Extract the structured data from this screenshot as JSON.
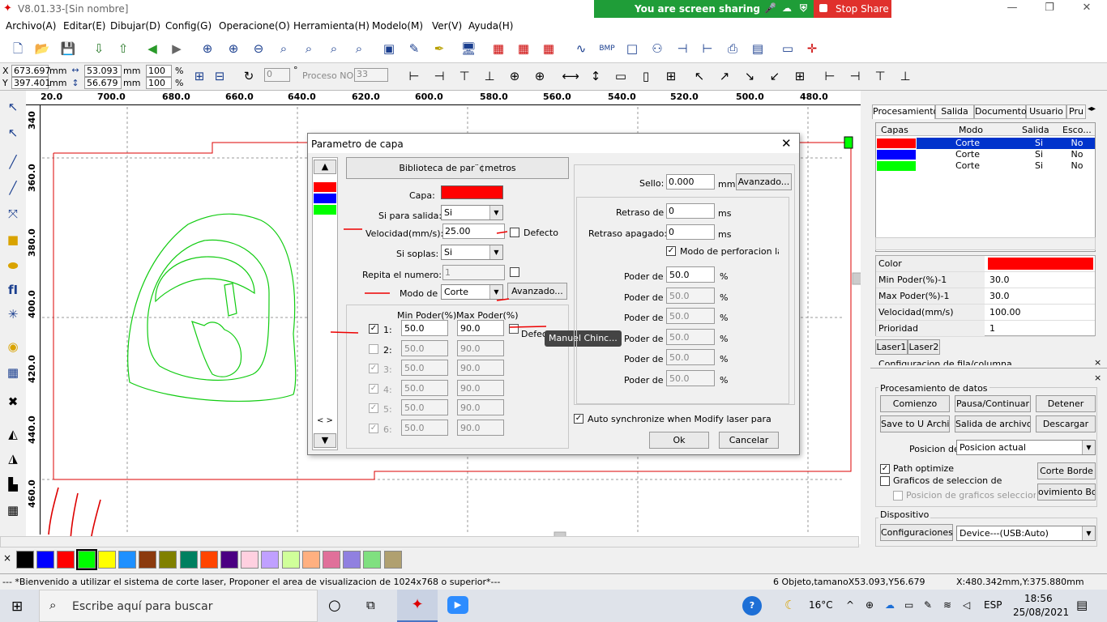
{
  "window": {
    "title": "V8.01.33-[Sin nombre]"
  },
  "screen_share": {
    "text": "You are screen sharing",
    "stop": "Stop Share"
  },
  "menu": [
    "Archivo(A)",
    "Editar(E)",
    "Dibujar(D)",
    "Config(G)",
    "Operacione(O)",
    "Herramienta(H)",
    "Modelo(M)",
    "Ver(V)",
    "Ayuda(H)"
  ],
  "coords": {
    "x_label": "X",
    "y_label": "Y",
    "x": "673.697",
    "y": "397.401",
    "unit": "mm",
    "w": "53.093",
    "h": "56.679",
    "pct_w": "100",
    "pct_h": "100",
    "pct": "%",
    "angle": "0",
    "deg": "°",
    "proceso_label": "Proceso NO:",
    "proceso": "33"
  },
  "ruler_top": [
    "20.0",
    "700.0",
    "680.0",
    "660.0",
    "640.0",
    "620.0",
    "600.0",
    "580.0",
    "560.0",
    "540.0",
    "520.0",
    "500.0",
    "480.0"
  ],
  "ruler_left": [
    "340",
    "360.0",
    "380.0",
    "400.0",
    "420.0",
    "440.0",
    "460.0"
  ],
  "palette_colors": [
    "#000000",
    "#0000ff",
    "#ff0000",
    "#00ff00",
    "#ffff00",
    "#1e90ff",
    "#8b3a0e",
    "#808000",
    "#008060",
    "#ff4500",
    "#4b0082",
    "#ffd0e0",
    "#c0a0ff",
    "#d0ff9a",
    "#ffb080",
    "#e0709a",
    "#9080e0",
    "#80e080",
    "#b0a070"
  ],
  "status": {
    "left": "--- *Bienvenido a utilizar el sistema de corte laser, Proponer el area de visualizacion de 1024x768 o superior*---",
    "mid": "6 Objeto,tamanoX53.093,Y56.679",
    "right": "X:480.342mm,Y:375.880mm"
  },
  "right_panel": {
    "tabs": [
      "Procesamiento",
      "Salida",
      "Documento",
      "Usuario",
      "Pru"
    ],
    "layer_headers": [
      "Capas",
      "Modo",
      "Salida",
      "Esco..."
    ],
    "layers": [
      {
        "color": "#ff0000",
        "mode": "Corte",
        "out": "Si",
        "esc": "No",
        "selected": true
      },
      {
        "color": "#0000ff",
        "mode": "Corte",
        "out": "Si",
        "esc": "No",
        "selected": false
      },
      {
        "color": "#00ff00",
        "mode": "Corte",
        "out": "Si",
        "esc": "No",
        "selected": false
      }
    ],
    "props": [
      {
        "k": "Color",
        "v": ""
      },
      {
        "k": "Min Poder(%)-1",
        "v": "30.0"
      },
      {
        "k": "Max Poder(%)-1",
        "v": "30.0"
      },
      {
        "k": "Velocidad(mm/s)",
        "v": "100.00"
      },
      {
        "k": "Prioridad",
        "v": "1"
      }
    ],
    "prop_color": "#ff0000",
    "laser_tabs": [
      "Laser1",
      "Laser2"
    ],
    "cut_text": "Configuracion de fila/columna",
    "datos": {
      "title": "Procesamiento de datos",
      "b1": "Comienzo",
      "b2": "Pausa/Continuar",
      "b3": "Detener",
      "b4": "Save to U Archivo",
      "b5": "Salida de archivo U",
      "b6": "Descargar",
      "pos_label": "Posicion de",
      "pos_value": "Posicion actual",
      "path_opt": "Path optimize",
      "graficos": "Graficos de seleccion de",
      "pos_graf": "Posicion de graficos seleccionado",
      "corte_borde": "Corte Borde",
      "mov_borde": "ovimiento Bord"
    },
    "dispositivo": {
      "title": "Dispositivo",
      "config": "Configuraciones",
      "device": "Device---(USB:Auto)"
    }
  },
  "dialog": {
    "title": "Parametro de capa",
    "biblioteca": "Biblioteca de par¨¢metros",
    "capa_label": "Capa:",
    "capa_color": "#ff0000",
    "salida_label": "Si para salida:",
    "salida": "Si",
    "vel_label": "Velocidad(mm/s):",
    "vel": "25.00",
    "defecto": "Defecto",
    "soplas_label": "Si soplas:",
    "soplas": "Si",
    "repita_label": "Repita el numero:",
    "repita": "1",
    "modo_label": "Modo de",
    "modo": "Corte",
    "avanzado": "Avanzado...",
    "min_hdr": "Min Poder(%)",
    "max_hdr": "Max Poder(%)",
    "lasers": [
      {
        "n": "1:",
        "min": "50.0",
        "max": "90.0"
      },
      {
        "n": "2:",
        "min": "50.0",
        "max": "90.0"
      },
      {
        "n": "3:",
        "min": "50.0",
        "max": "90.0"
      },
      {
        "n": "4:",
        "min": "50.0",
        "max": "90.0"
      },
      {
        "n": "5:",
        "min": "50.0",
        "max": "90.0"
      },
      {
        "n": "6:",
        "min": "50.0",
        "max": "90.0"
      }
    ],
    "defecto2": "Defec",
    "tooltip": "Manuel Chinc...",
    "sello_label": "Sello:",
    "sello": "0.000",
    "mm": "mm",
    "avanzado2": "Avanzado...",
    "retraso_label": "Retraso de",
    "retraso": "0",
    "ms": "ms",
    "retraso_ap_label": "Retraso apagado:",
    "retraso_ap": "0",
    "perforacion": "Modo de perforacion lase",
    "poder_label": "Poder de",
    "pct": "%",
    "poder": [
      "50.0",
      "50.0",
      "50.0",
      "50.0",
      "50.0",
      "50.0"
    ],
    "auto_sync": "Auto synchronize when Modify laser para",
    "ok": "Ok",
    "cancelar": "Cancelar",
    "layer_colors": [
      "#ff0000",
      "#0000ff",
      "#00ff00"
    ]
  },
  "taskbar": {
    "search": "Escribe aquí para buscar",
    "temp": "16°C",
    "lang": "ESP",
    "time": "18:56",
    "date": "25/08/2021"
  }
}
